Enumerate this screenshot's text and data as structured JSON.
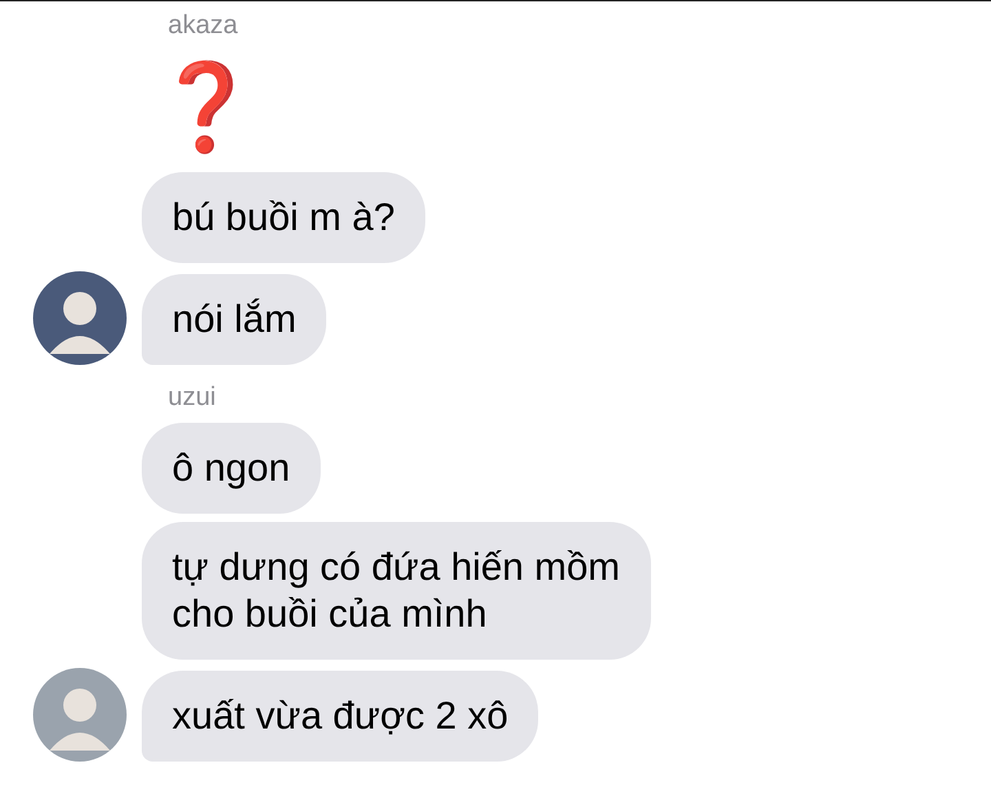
{
  "groups": [
    {
      "sender": "akaza",
      "messages": [
        {
          "kind": "emoji",
          "text": "❓"
        },
        {
          "kind": "text",
          "text": "bú buồi m à?"
        },
        {
          "kind": "text",
          "text": "nói lắm"
        }
      ]
    },
    {
      "sender": "uzui",
      "messages": [
        {
          "kind": "text",
          "text": "ô ngon"
        },
        {
          "kind": "text",
          "text": "tự dưng có đứa hiến mồm\ncho buồi của mình"
        },
        {
          "kind": "text",
          "text": "xuất vừa được 2 xô"
        }
      ]
    }
  ]
}
